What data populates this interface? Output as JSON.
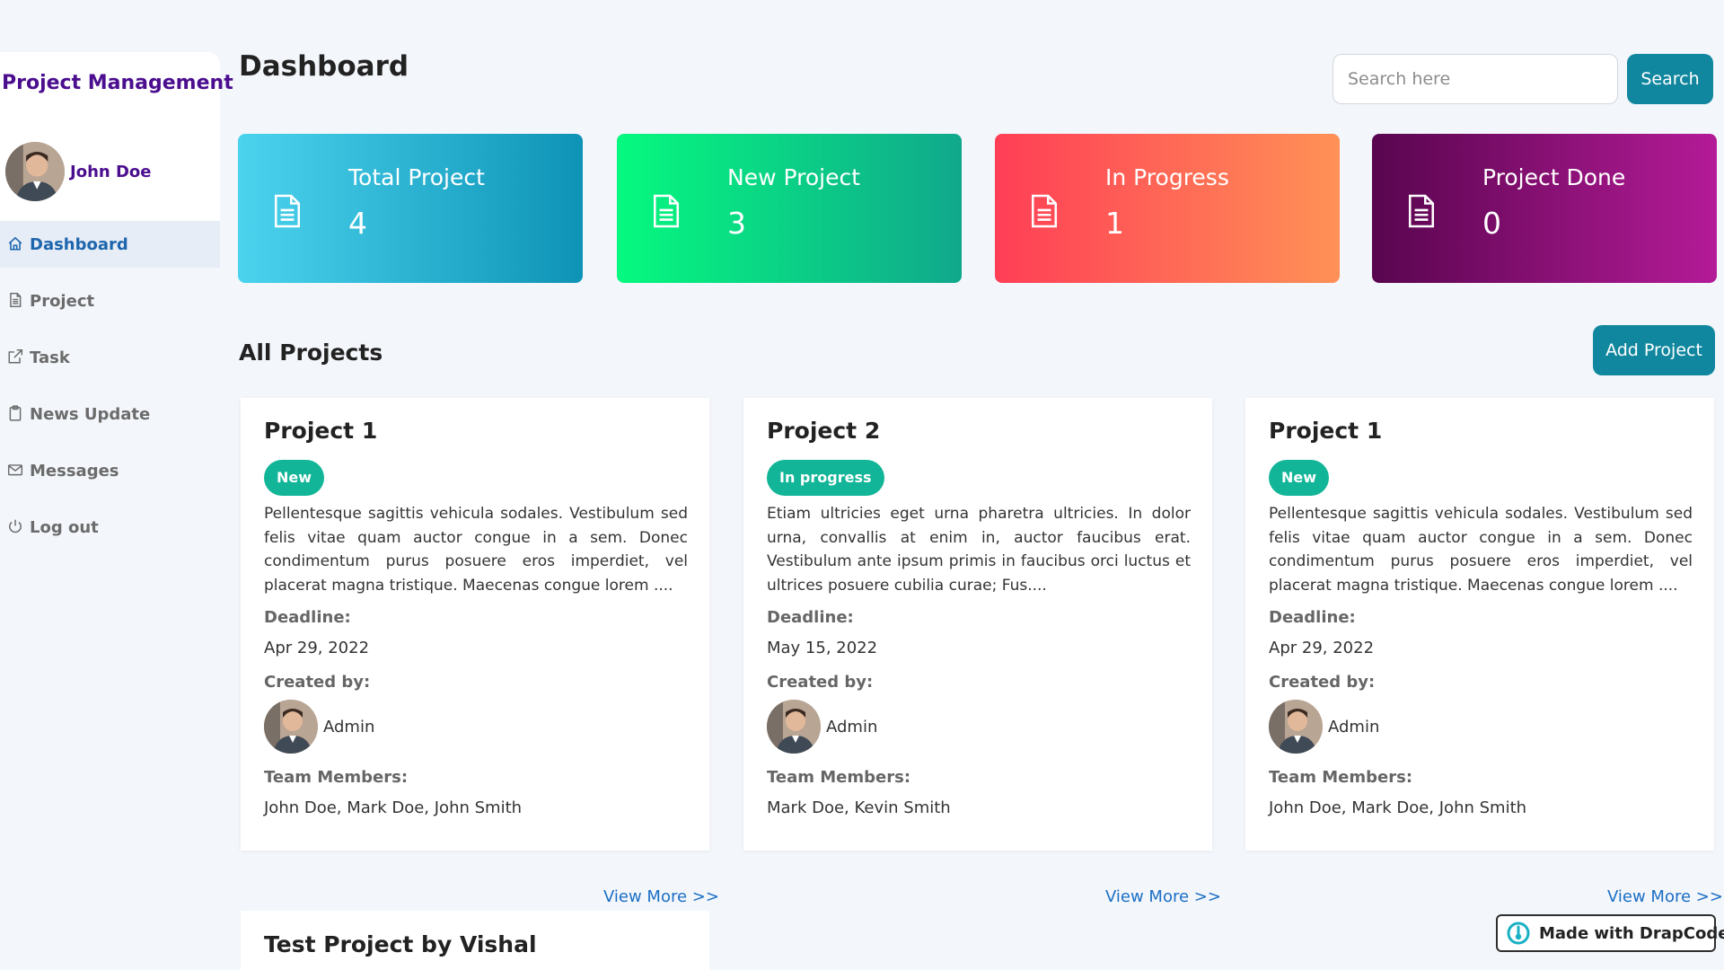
{
  "sidebar": {
    "brand": "Project Management",
    "user_name": "John Doe",
    "items": [
      {
        "label": "Dashboard",
        "icon": "home-icon",
        "active": true
      },
      {
        "label": "Project",
        "icon": "document-icon"
      },
      {
        "label": "Task",
        "icon": "external-link-icon"
      },
      {
        "label": "News Update",
        "icon": "clipboard-icon"
      },
      {
        "label": "Messages",
        "icon": "envelope-icon"
      },
      {
        "label": "Log out",
        "icon": "power-icon"
      }
    ]
  },
  "header": {
    "title": "Dashboard",
    "search_placeholder": "Search here",
    "search_label": "Search"
  },
  "stats": [
    {
      "label": "Total Project",
      "value": "4",
      "icon": "document-icon",
      "colors": [
        "#4bd3ee",
        "#0e93b6"
      ]
    },
    {
      "label": "New Project",
      "value": "3",
      "icon": "document-icon",
      "colors": [
        "#05f97f",
        "#10a88c"
      ]
    },
    {
      "label": "In Progress",
      "value": "1",
      "icon": "document-icon",
      "colors": [
        "#ff3e56",
        "#ff9156"
      ]
    },
    {
      "label": "Project Done",
      "value": "0",
      "icon": "document-icon",
      "colors": [
        "#59054f",
        "#b41b97"
      ]
    }
  ],
  "projects_section": {
    "title": "All Projects",
    "add_label": "Add Project"
  },
  "labels": {
    "deadline": "Deadline:",
    "created_by": "Created by:",
    "team_members": "Team Members:",
    "view_more": "View More >>"
  },
  "projects": [
    {
      "title": "Project 1",
      "status": "New",
      "description": "Pellentesque sagittis vehicula sodales. Vestibulum sed felis vitae quam auctor congue in a sem. Donec condimentum purus posuere eros imperdiet, vel placerat magna tristique. Maecenas congue lorem ....",
      "deadline": "Apr 29, 2022",
      "created_by": "Admin",
      "team_members": "John Doe, Mark Doe, John Smith"
    },
    {
      "title": "Project 2",
      "status": "In progress",
      "description": "Etiam ultricies eget urna pharetra ultricies. In dolor urna, convallis at enim in, auctor faucibus erat. Vestibulum ante ipsum primis in faucibus orci luctus et ultrices posuere cubilia curae; Fus....",
      "deadline": "May 15, 2022",
      "created_by": "Admin",
      "team_members": "Mark Doe, Kevin Smith"
    },
    {
      "title": "Project 1",
      "status": "New",
      "description": "Pellentesque sagittis vehicula sodales. Vestibulum sed felis vitae quam auctor congue in a sem. Donec condimentum purus posuere eros imperdiet, vel placerat magna tristique. Maecenas congue lorem ....",
      "deadline": "Apr 29, 2022",
      "created_by": "Admin",
      "team_members": "John Doe, Mark Doe, John Smith"
    },
    {
      "title": "Test Project by Vishal"
    }
  ],
  "badge": {
    "text": "Made with DrapCode",
    "icon": "drapcode-logo-icon"
  },
  "colors": {
    "accent": "#11879f",
    "brand": "#4b0e8f",
    "active_nav": "#1d66ad",
    "status_badge": "#12b597",
    "link": "#1b6fc4"
  }
}
